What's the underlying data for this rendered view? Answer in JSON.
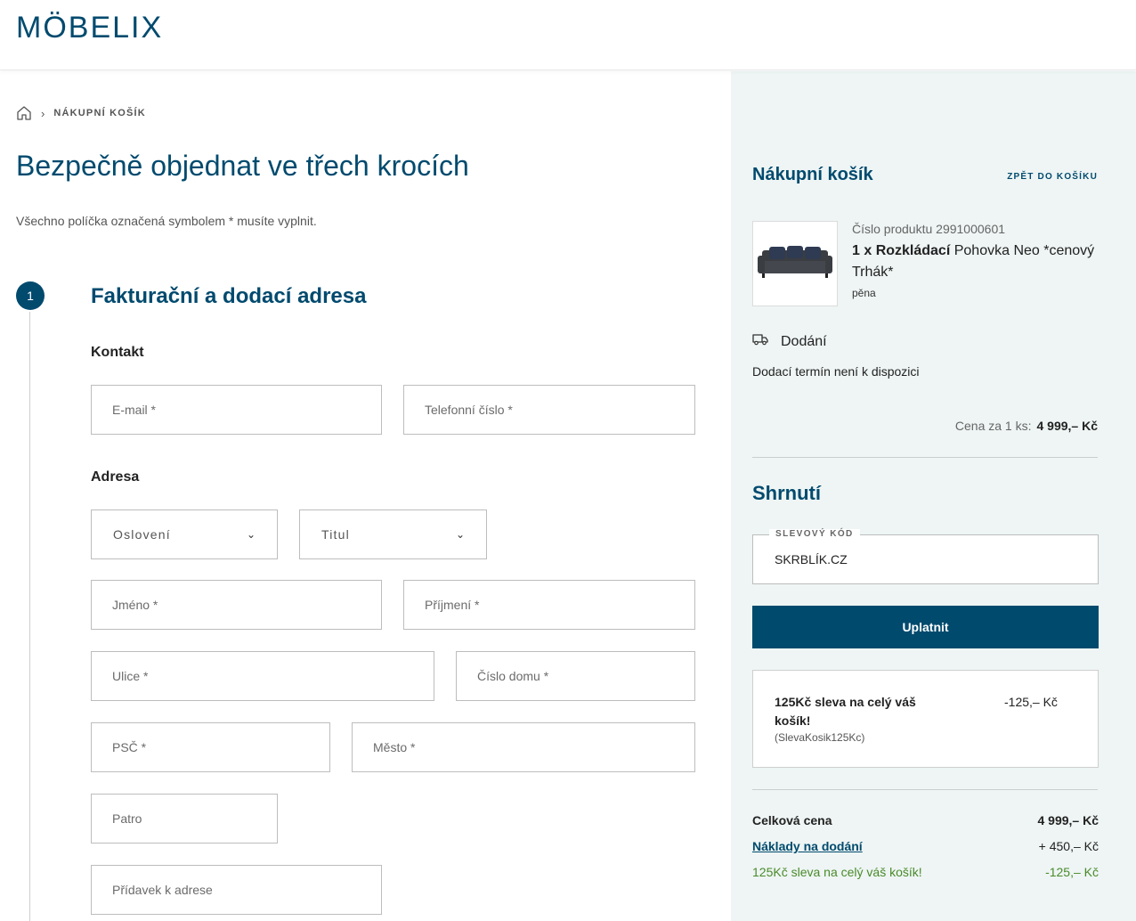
{
  "brand": {
    "logo": "MÖBELIX"
  },
  "breadcrumb": {
    "current": "NÁKUPNÍ KOŠÍK"
  },
  "page": {
    "title": "Bezpečně objednat ve třech krocích",
    "required_note": "Všechno políčka označená symbolem * musíte vyplnit."
  },
  "step1": {
    "number": "1",
    "title": "Fakturační a dodací adresa",
    "contact_label": "Kontakt",
    "address_label": "Adresa",
    "fields": {
      "email": "E-mail *",
      "phone": "Telefonní číslo *",
      "salutation": "Oslovení",
      "title": "Titul",
      "first_name": "Jméno *",
      "last_name": "Příjmení *",
      "street": "Ulice *",
      "house_number": "Číslo domu *",
      "zip": "PSČ *",
      "city": "Město *",
      "floor": "Patro",
      "address_extra": "Přídavek k adrese"
    }
  },
  "cart": {
    "title": "Nákupní košík",
    "back_link": "ZPĚT DO KOŠÍKU",
    "product": {
      "number_text": "Číslo produktu 2991000601",
      "qty_bold": "1 x Rozkládací",
      "name_rest": " Pohovka Neo *cenový Trhák*",
      "variant": "pěna"
    },
    "delivery_label": "Dodání",
    "delivery_note": "Dodací termín není k dispozici",
    "unit_price_label": "Cena za 1 ks:",
    "unit_price": "4 999,– Kč"
  },
  "summary": {
    "title": "Shrnutí",
    "coupon_label": "SLEVOVÝ KÓD",
    "coupon_value": "SKRBLÍK.CZ",
    "apply_button": "Uplatnit",
    "promo": {
      "title": "125Kč sleva na celý váš košík!",
      "code": "(SlevaKosik125Kc)",
      "amount": "-125,– Kč"
    },
    "rows": {
      "total_label": "Celková cena",
      "total_value": "4 999,– Kč",
      "shipping_label": "Náklady na dodání",
      "shipping_value": "+ 450,– Kč",
      "discount_label": "125Kč sleva na celý váš košík!",
      "discount_value": "-125,– Kč"
    }
  },
  "colors": {
    "brand": "#004a6e",
    "sidebar_bg": "#eef5f4",
    "discount": "#4a8a2a"
  }
}
